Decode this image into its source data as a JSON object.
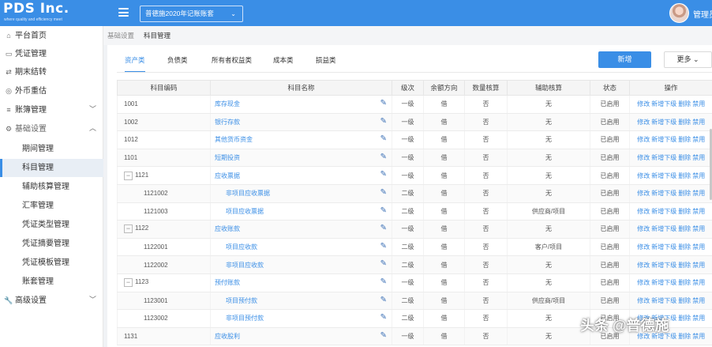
{
  "brand": {
    "name": "PDS Inc.",
    "tagline": "where quality and efficiency meet"
  },
  "header": {
    "account_set": "普德施2020年记账账套",
    "username": "管理员"
  },
  "sidebar": {
    "items": [
      {
        "label": "平台首页",
        "icon": "home-icon"
      },
      {
        "label": "凭证管理",
        "icon": "voucher-icon"
      },
      {
        "label": "期末结转",
        "icon": "transfer-icon"
      },
      {
        "label": "外币重估",
        "icon": "currency-icon"
      },
      {
        "label": "账簿管理",
        "icon": "ledger-icon"
      },
      {
        "label": "基础设置",
        "icon": "settings-icon"
      },
      {
        "label": "高级设置",
        "icon": "wrench-icon"
      }
    ],
    "sub_items": [
      "期间管理",
      "科目管理",
      "辅助核算管理",
      "汇率管理",
      "凭证类型管理",
      "凭证摘要管理",
      "凭证模板管理",
      "账套管理"
    ]
  },
  "breadcrumb": {
    "parent": "基础设置",
    "current": "科目管理"
  },
  "tabs": [
    "资产类",
    "负债类",
    "所有者权益类",
    "成本类",
    "损益类"
  ],
  "actions": {
    "new": "新增",
    "more": "更多"
  },
  "table": {
    "headers": [
      "科目编码",
      "科目名称",
      "级次",
      "余额方向",
      "数量核算",
      "辅助核算",
      "状态",
      "操作"
    ],
    "op_labels": [
      "修改",
      "新增下级",
      "删除",
      "禁用"
    ],
    "rows": [
      {
        "code": "1001",
        "name": "库存现金",
        "level": "一级",
        "direction": "借",
        "qty": "否",
        "aux": "无",
        "status": "已启用"
      },
      {
        "code": "1002",
        "name": "银行存款",
        "level": "一级",
        "direction": "借",
        "qty": "否",
        "aux": "无",
        "status": "已启用"
      },
      {
        "code": "1012",
        "name": "其他货币资金",
        "level": "一级",
        "direction": "借",
        "qty": "否",
        "aux": "无",
        "status": "已启用"
      },
      {
        "code": "1101",
        "name": "短期投资",
        "level": "一级",
        "direction": "借",
        "qty": "否",
        "aux": "无",
        "status": "已启用"
      },
      {
        "code": "1121",
        "name": "应收票据",
        "level": "一级",
        "direction": "借",
        "qty": "否",
        "aux": "无",
        "status": "已启用"
      },
      {
        "code": "1121002",
        "name": "非项目应收票据",
        "level": "二级",
        "direction": "借",
        "qty": "否",
        "aux": "无",
        "status": "已启用"
      },
      {
        "code": "1121003",
        "name": "项目应收票据",
        "level": "二级",
        "direction": "借",
        "qty": "否",
        "aux": "供应商/项目",
        "status": "已启用"
      },
      {
        "code": "1122",
        "name": "应收账款",
        "level": "一级",
        "direction": "借",
        "qty": "否",
        "aux": "无",
        "status": "已启用"
      },
      {
        "code": "1122001",
        "name": "项目应收款",
        "level": "二级",
        "direction": "借",
        "qty": "否",
        "aux": "客户/项目",
        "status": "已启用"
      },
      {
        "code": "1122002",
        "name": "非项目应收款",
        "level": "二级",
        "direction": "借",
        "qty": "否",
        "aux": "无",
        "status": "已启用"
      },
      {
        "code": "1123",
        "name": "预付账款",
        "level": "一级",
        "direction": "借",
        "qty": "否",
        "aux": "无",
        "status": "已启用"
      },
      {
        "code": "1123001",
        "name": "项目预付款",
        "level": "二级",
        "direction": "借",
        "qty": "否",
        "aux": "供应商/项目",
        "status": "已启用"
      },
      {
        "code": "1123002",
        "name": "非项目预付款",
        "level": "二级",
        "direction": "借",
        "qty": "否",
        "aux": "无",
        "status": "已启用"
      },
      {
        "code": "1131",
        "name": "应收股利",
        "level": "一级",
        "direction": "借",
        "qty": "否",
        "aux": "无",
        "status": "已启用"
      }
    ]
  },
  "watermark": "头条 @普德施",
  "colors": {
    "primary": "#3a8ee6",
    "sidebar_active": "#e8eef5"
  }
}
